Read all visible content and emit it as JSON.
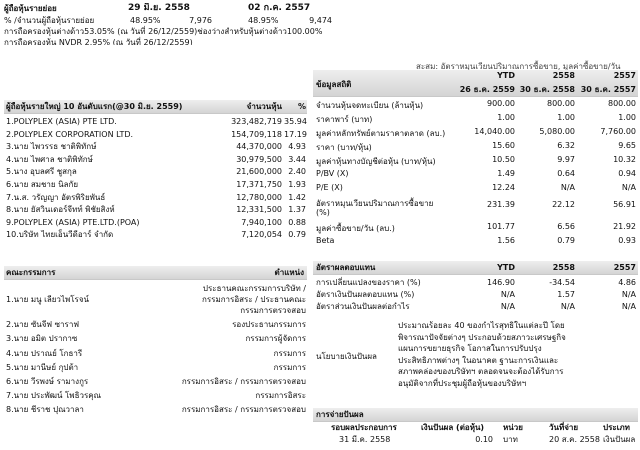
{
  "top": {
    "label_date_row": "ผู้ถือหุ้นรายย่อย",
    "date1": "29 มิ.ย. 2558",
    "date2": "02 ก.ค. 2557",
    "pct_label": "% /จำนวนผู้ถือหุ้นรายย่อย",
    "pct1": "48.95%",
    "cnt1": "7,976",
    "pct2": "48.95%",
    "cnt2": "9,474",
    "foreign1": "การถือครองหุ้นต่างด้าว53.05% (ณ วันที่ 26/12/2559)ช่องว่างสำหรับหุ้นต่างด้าว100.00%",
    "nvdr": "การถือครองหุ้น NVDR 2.95% (ณ วันที่ 26/12/2559)"
  },
  "shareholders": {
    "title": "ผู้ถือหุ้นรายใหญ่ 10 อันดับแรก(@30 มิ.ย. 2559)",
    "col_shares": "จำนวนหุ้น",
    "col_pct": "%",
    "rows": [
      {
        "name": "1.POLYPLEX (ASIA) PTE LTD.",
        "shares": "323,482,719",
        "pct": "35.94"
      },
      {
        "name": "2.POLYPLEX CORPORATION LTD.",
        "shares": "154,709,118",
        "pct": "17.19"
      },
      {
        "name": "3.นาย ไพวรรธ ชาติพิทักษ์",
        "shares": "44,370,000",
        "pct": "4.93"
      },
      {
        "name": "4.นาย ไพศาล ชาติพิทักษ์",
        "shares": "30,979,500",
        "pct": "3.44"
      },
      {
        "name": "5.นาง อุบลศรี ชูสกุล",
        "shares": "21,600,000",
        "pct": "2.40"
      },
      {
        "name": "6.นาย สมชาย นิลกัย",
        "shares": "17,371,750",
        "pct": "1.93"
      },
      {
        "name": "7.น.ส. วรัญญา อัตรพิริยพันธ์",
        "shares": "12,780,000",
        "pct": "1.42"
      },
      {
        "name": "8.นาย ยัสวินเดอร์จีทท์ พิชัยสิงห์",
        "shares": "12,331,500",
        "pct": "1.37"
      },
      {
        "name": "9.POLYPLEX (ASIA) PTE.LTD.(POA)",
        "shares": "7,940,100",
        "pct": "0.88"
      },
      {
        "name": "10.บริษัท ไทยเอ็นวีดีอาร์ จำกัด",
        "shares": "7,120,054",
        "pct": "0.79"
      }
    ]
  },
  "board": {
    "title": "คณะกรรมการ",
    "col_pos": "ตำแหน่ง",
    "rows": [
      {
        "name": "1.นาย มนู เลียวไพโรจน์",
        "pos": [
          "ประธานคณะกรรมการบริษัท /",
          "กรรมการอิสระ / ประธานคณะ",
          "กรรมการตรวจสอบ"
        ]
      },
      {
        "name": "2.นาย ซันจีฟ ซาราฟ",
        "pos": [
          "รองประธานกรรมการ"
        ]
      },
      {
        "name": "3.นาย อมิต ปรากาซ",
        "pos": [
          "กรรมการผู้จัดการ"
        ]
      },
      {
        "name": "4.นาย ปราณย์ โกธารี",
        "pos": [
          "กรรมการ"
        ]
      },
      {
        "name": "5.นาย มานีษย์ กุปต้า",
        "pos": [
          "กรรมการ"
        ]
      },
      {
        "name": "6.นาย วีรพงษ์ รามางกูร",
        "pos": [
          "กรรมการอิสระ / กรรมการตรวจสอบ"
        ]
      },
      {
        "name": "7.นาย ประพัฒน์ โพธิวรคุณ",
        "pos": [
          "กรรมการอิสระ"
        ]
      },
      {
        "name": "8.นาย ชีราช ปุณวาลา",
        "pos": [
          "กรรมการอิสระ / กรรมการตรวจสอบ"
        ]
      }
    ]
  },
  "stats": {
    "note": "สะสม: อัตราหมุนเวียนปริมาณการซื้อขาย, มูลค่าซื้อขาย/วัน",
    "title": "ข้อมูลสถิติ",
    "h1": "YTD",
    "h2": "2558",
    "h3": "2557",
    "d1": "26 ธ.ค. 2559",
    "d2": "30 ธ.ค. 2558",
    "d3": "30 ธ.ค. 2557",
    "rows": [
      {
        "label": [
          "จำนวนหุ้นจดทะเบียน (ล้านหุ้น)"
        ],
        "v1": "900.00",
        "v2": "800.00",
        "v3": "800.00"
      },
      {
        "label": [
          "ราคาพาร์ (บาท)"
        ],
        "v1": "1.00",
        "v2": "1.00",
        "v3": "1.00"
      },
      {
        "label": [
          "มูลค่าหลักทรัพย์ตามราคาตลาด (ลบ.)"
        ],
        "v1": "14,040.00",
        "v2": "5,080.00",
        "v3": "7,760.00"
      },
      {
        "label": [
          "ราคา (บาท/หุ้น)"
        ],
        "v1": "15.60",
        "v2": "6.32",
        "v3": "9.65"
      },
      {
        "label": [
          "มูลค่าหุ้นทางบัญชีต่อหุ้น (บาท/หุ้น)"
        ],
        "v1": "10.50",
        "v2": "9.97",
        "v3": "10.32"
      },
      {
        "label": [
          "P/BV (X)"
        ],
        "v1": "1.49",
        "v2": "0.64",
        "v3": "0.94"
      },
      {
        "label": [
          "P/E (X)"
        ],
        "v1": "12.24",
        "v2": "N/A",
        "v3": "N/A"
      },
      {
        "label": [
          "อัตราหมุนเวียนปริมาณการซื้อขาย",
          "(%)"
        ],
        "v1": "231.39",
        "v2": "22.12",
        "v3": "56.91"
      },
      {
        "label": [
          "มูลค่าซื้อขาย/วัน (ลบ.)"
        ],
        "v1": "101.77",
        "v2": "6.56",
        "v3": "21.92"
      },
      {
        "label": [
          "Beta"
        ],
        "v1": "1.56",
        "v2": "0.79",
        "v3": "0.93"
      }
    ]
  },
  "returns": {
    "title": "อัตราผลตอบแทน",
    "h1": "YTD",
    "h2": "2558",
    "h3": "2557",
    "rows": [
      {
        "label": "การเปลี่ยนแปลงของราคา (%)",
        "v1": "146.90",
        "v2": "-34.54",
        "v3": "4.86"
      },
      {
        "label": "อัตราเงินปันผลตอบแทน (%)",
        "v1": "N/A",
        "v2": "1.57",
        "v3": "N/A"
      },
      {
        "label": "อัตราส่วนเงินปันผลต่อกำไร",
        "v1": "N/A",
        "v2": "N/A",
        "v3": "N/A"
      }
    ]
  },
  "policy": {
    "label": "นโยบายเงินปันผล",
    "text": [
      "ประมาณร้อยละ 40 ของกำไรสุทธิในแต่ละปี โดย",
      "พิจารณาปัจจัยต่างๆ ประกอบด้วยสภาวะเศรษฐกิจ",
      "แผนการขยายธุรกิจ โอกาสในการปรับปรุง",
      "ประสิทธิภาพต่างๆ ในอนาคต ฐานะการเงินและ",
      "สภาพคล่องของบริษัทฯ ตลอดจนจะต้องได้รับการ",
      "อนุมัติจากที่ประชุมผู้ถือหุ้นของบริษัทฯ"
    ]
  },
  "dividend": {
    "title": "การจ่ายปันผล",
    "cols": [
      "รอบผลประกอบการ",
      "เงินปันผล (ต่อหุ้น)",
      "หน่วย",
      "วันที่จ่าย",
      "ประเภท"
    ],
    "rows": [
      {
        "period": "31 มี.ค. 2558",
        "amount": "0.10",
        "unit": "บาท",
        "date": "20 ส.ค. 2558",
        "type": "เงินปันผล"
      }
    ]
  }
}
